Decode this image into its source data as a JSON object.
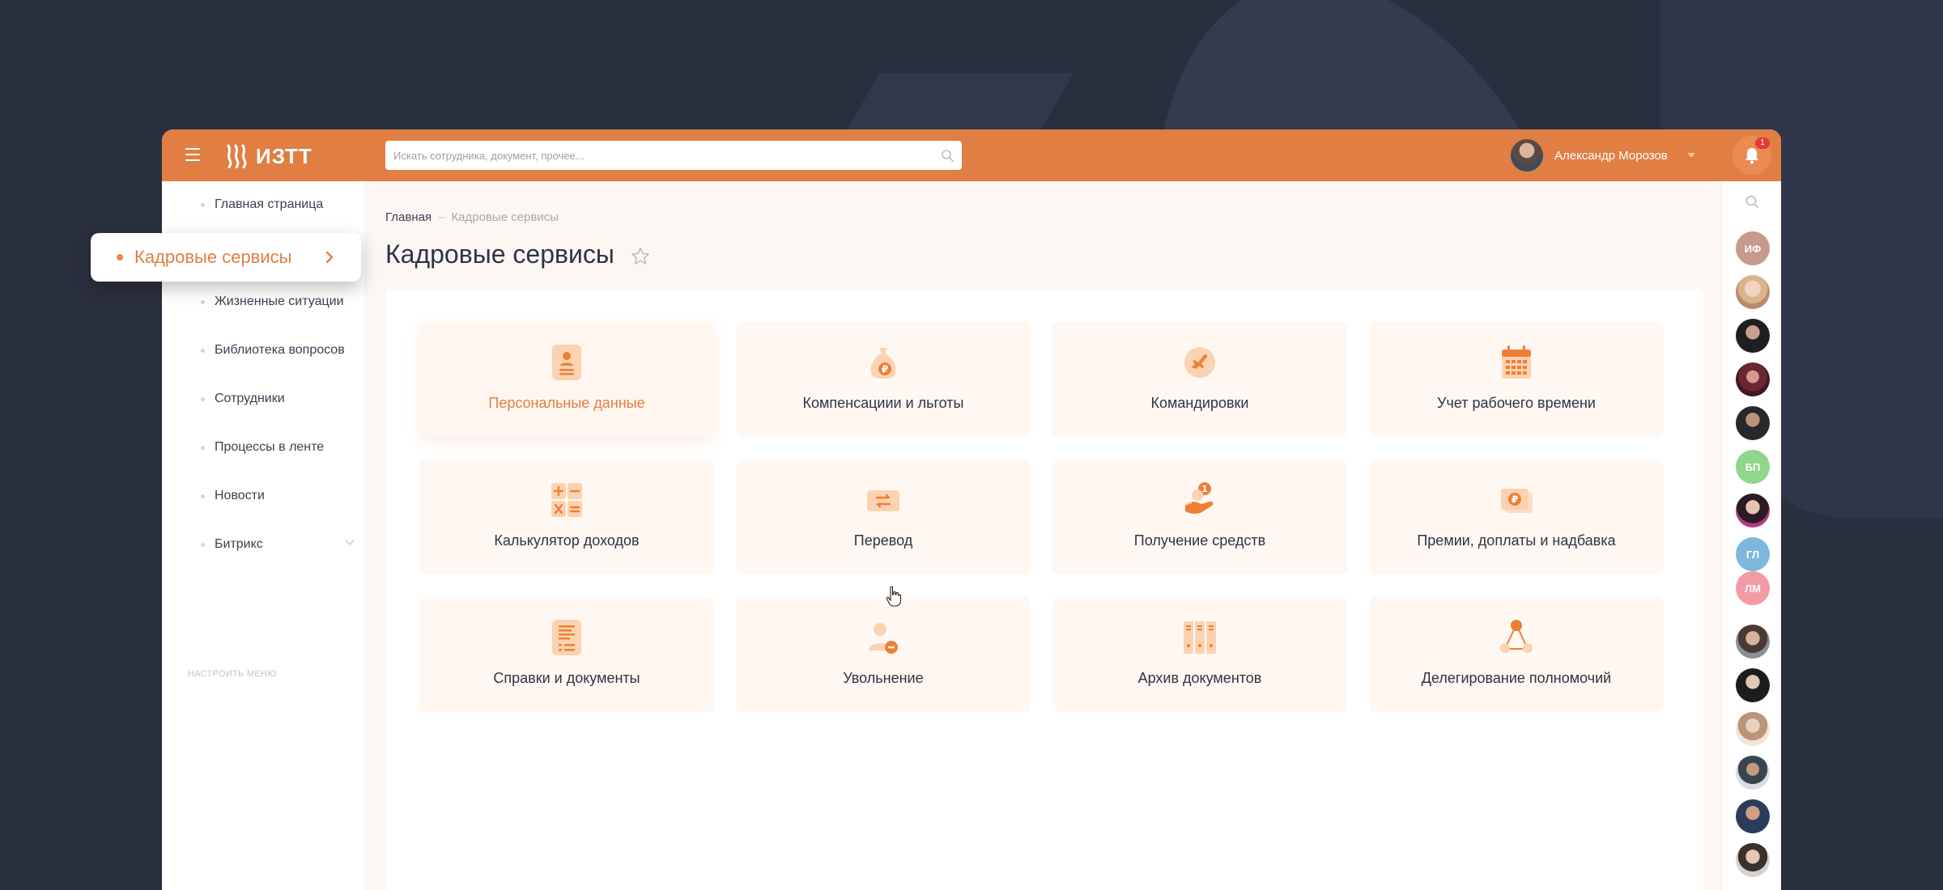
{
  "colors": {
    "accent": "#e07e44",
    "header_bg": "#e07e44",
    "card_bg": "#fff7f1",
    "text_dark": "#2e3446",
    "icon_light": "#fbd2b2",
    "icon_dark": "#ee7f36"
  },
  "header": {
    "menu_icon": "hamburger-icon",
    "logo_text": "ИЗТТ",
    "search_placeholder": "Искать сотрудника, документ, прочее...",
    "user_name": "Александр Морозов",
    "notifications_count": "1"
  },
  "sidebar": {
    "items": [
      {
        "label": "Главная страница"
      },
      {
        "label": "Кадровые сервисы"
      },
      {
        "label": "Жизненные ситуации"
      },
      {
        "label": "Библиотека вопросов"
      },
      {
        "label": "Сотрудники"
      },
      {
        "label": "Процессы в ленте"
      },
      {
        "label": "Новости"
      },
      {
        "label": "Битрикс"
      }
    ],
    "setup_label": "НАСТРОИТЬ МЕНЮ"
  },
  "breadcrumb": {
    "home": "Главная",
    "separator": "–",
    "current": "Кадровые сервисы"
  },
  "page": {
    "title": "Кадровые сервисы"
  },
  "services": [
    {
      "label": "Персональные данные",
      "icon": "personal-data-icon"
    },
    {
      "label": "Компенсациии и льготы",
      "icon": "money-bag-icon"
    },
    {
      "label": "Командировки",
      "icon": "airplane-icon"
    },
    {
      "label": "Учет рабочего времени",
      "icon": "calendar-icon"
    },
    {
      "label": "Калькулятор доходов",
      "icon": "calculator-icon"
    },
    {
      "label": "Перевод",
      "icon": "transfer-icon"
    },
    {
      "label": "Получение средств",
      "icon": "hand-coin-icon"
    },
    {
      "label": "Премии, доплаты и надбавка",
      "icon": "bonus-icon"
    },
    {
      "label": "Справки и документы",
      "icon": "document-icon"
    },
    {
      "label": "Увольнение",
      "icon": "dismissal-icon"
    },
    {
      "label": "Архив документов",
      "icon": "archive-icon"
    },
    {
      "label": "Делегирование полномочий",
      "icon": "delegation-icon"
    }
  ],
  "rail": {
    "initials": [
      "ИФ",
      "БП",
      "ГЛ",
      "ЛМ"
    ]
  }
}
